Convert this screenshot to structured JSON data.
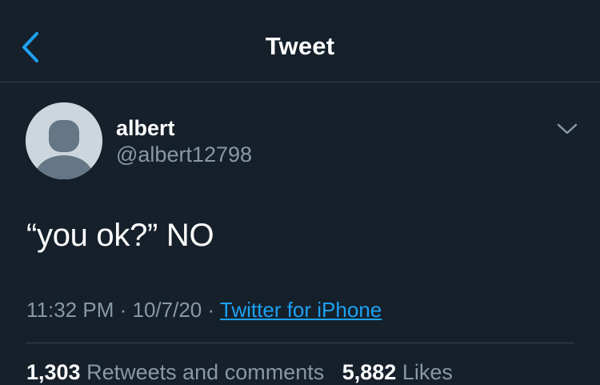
{
  "header": {
    "title": "Tweet",
    "back_icon": "chevron-left-icon"
  },
  "tweet": {
    "author_name": "albert",
    "author_handle": "@albert12798",
    "menu_icon": "chevron-down-icon",
    "text": "“you ok?” NO",
    "time": "11:32 PM",
    "separator": "·",
    "date": "10/7/20",
    "source": "Twitter for iPhone",
    "retweets_count": "1,303",
    "retweets_label": "Retweets and comments",
    "likes_count": "5,882",
    "likes_label": "Likes"
  },
  "colors": {
    "background": "#15202b",
    "accent": "#1da1f2",
    "secondary_text": "#8899a6",
    "border": "#38444d"
  }
}
